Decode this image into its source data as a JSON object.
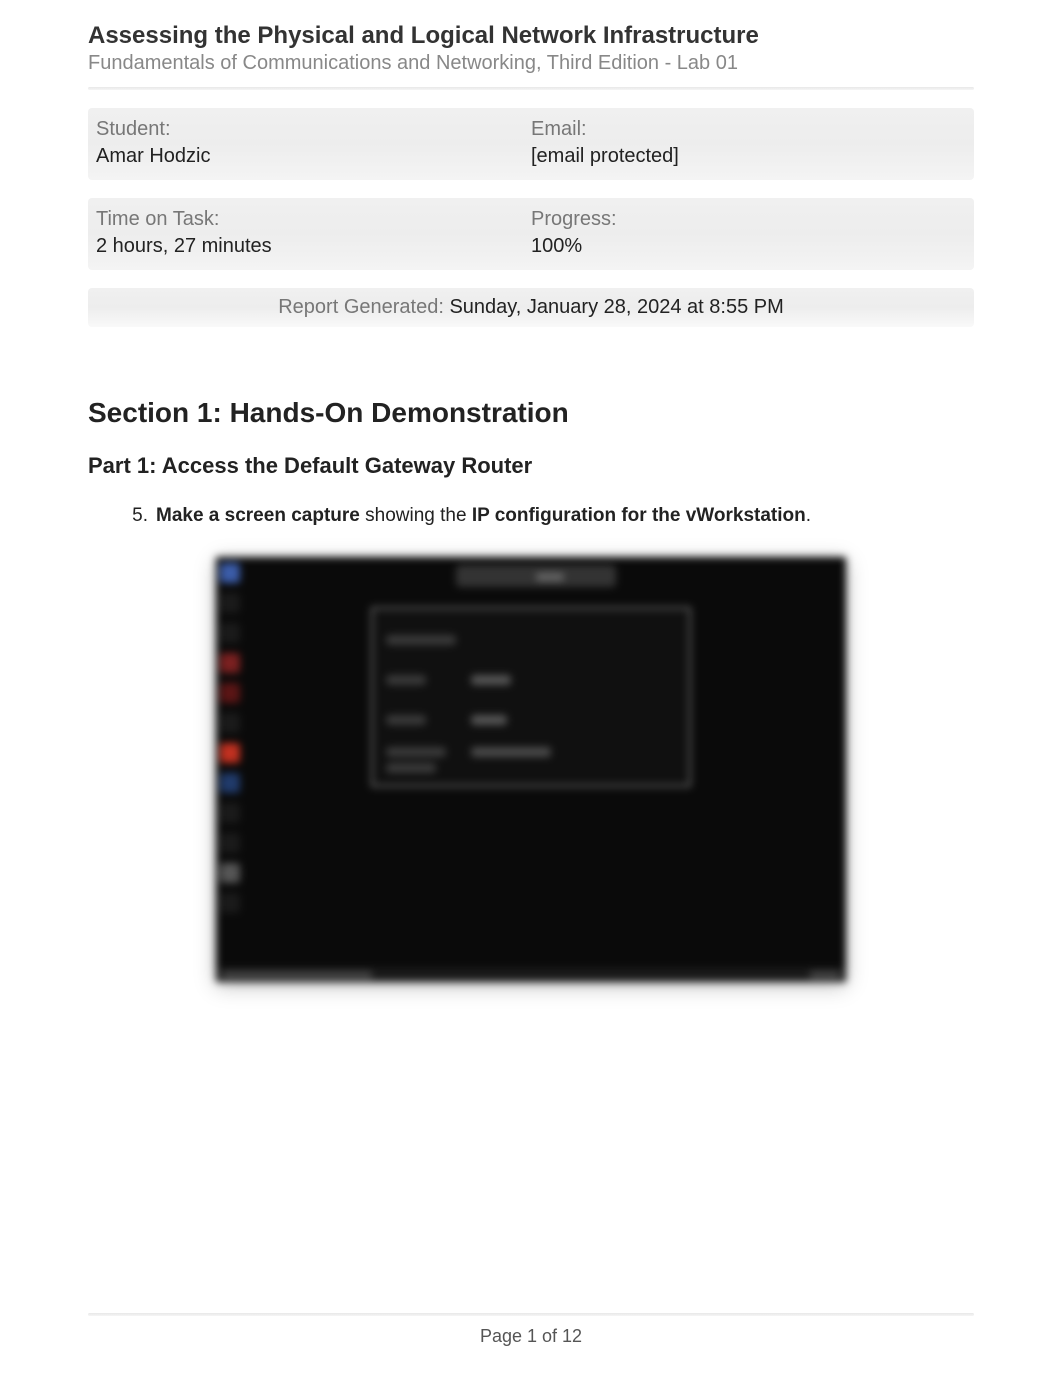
{
  "header": {
    "title": "Assessing the Physical and Logical Network Infrastructure",
    "subtitle": "Fundamentals of Communications and Networking, Third Edition - Lab 01"
  },
  "info": {
    "student_label": "Student:",
    "student_value": "Amar Hodzic",
    "email_label": "Email:",
    "email_value": "[email protected]",
    "time_label": "Time on Task:",
    "time_value": "2 hours, 27 minutes",
    "progress_label": "Progress:",
    "progress_value": "100%"
  },
  "report": {
    "label": "Report Generated:",
    "value": "Sunday, January 28, 2024 at 8:55 PM"
  },
  "section": {
    "heading": "Section 1: Hands-On Demonstration",
    "part_heading": "Part 1: Access the Default Gateway Router",
    "item_number": "5.",
    "item_bold1": "Make a screen capture",
    "item_mid": " showing the ",
    "item_bold2": "IP configuration for the vWorkstation",
    "item_end": "."
  },
  "footer": {
    "page": "Page 1 of 12"
  }
}
